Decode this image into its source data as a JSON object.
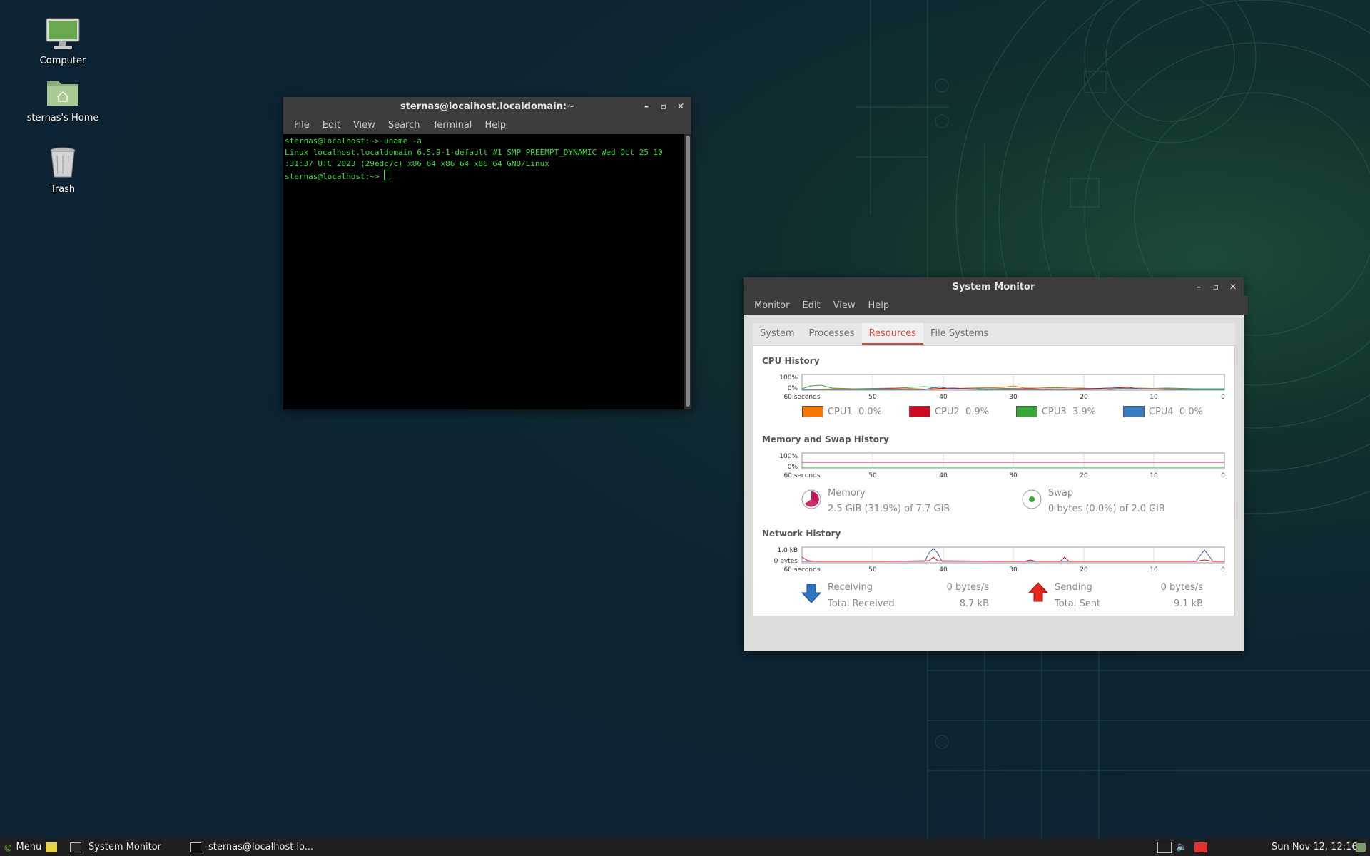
{
  "desktop": {
    "icons": [
      {
        "label": "Computer",
        "icon": "computer-icon"
      },
      {
        "label": "sternas's Home",
        "icon": "home-folder-icon"
      },
      {
        "label": "Trash",
        "icon": "trash-icon"
      }
    ]
  },
  "terminal": {
    "title": "sternas@localhost.localdomain:~",
    "menu": [
      "File",
      "Edit",
      "View",
      "Search",
      "Terminal",
      "Help"
    ],
    "lines": [
      "sternas@localhost:~> uname -a",
      "Linux localhost.localdomain 6.5.9-1-default #1 SMP PREEMPT_DYNAMIC Wed Oct 25 10",
      ":31:37 UTC 2023 (29edc7c) x86_64 x86_64 x86_64 GNU/Linux"
    ],
    "prompt": "sternas@localhost:~> "
  },
  "sysmon": {
    "title": "System Monitor",
    "menu": [
      "Monitor",
      "Edit",
      "View",
      "Help"
    ],
    "tabs": [
      "System",
      "Processes",
      "Resources",
      "File Systems"
    ],
    "active_tab": "Resources",
    "cpu": {
      "section": "CPU History",
      "y_top": "100%",
      "y_bottom": "0%",
      "x_ticks": [
        "60 seconds",
        "50",
        "40",
        "30",
        "20",
        "10",
        "0"
      ],
      "legend": [
        {
          "name": "CPU1",
          "value": "0.0%",
          "color": "#f57900"
        },
        {
          "name": "CPU2",
          "value": "0.9%",
          "color": "#cc0a22"
        },
        {
          "name": "CPU3",
          "value": "3.9%",
          "color": "#3aa53a"
        },
        {
          "name": "CPU4",
          "value": "0.0%",
          "color": "#3a7ac0"
        }
      ]
    },
    "memory": {
      "section": "Memory and Swap History",
      "y_top": "100%",
      "y_bottom": "0%",
      "x_ticks": [
        "60 seconds",
        "50",
        "40",
        "30",
        "20",
        "10",
        "0"
      ],
      "mem_label": "Memory",
      "mem_value": "2.5 GiB (31.9%) of 7.7 GiB",
      "swap_label": "Swap",
      "swap_value": "0 bytes (0.0%) of 2.0 GiB",
      "mem_color": "#c0185e",
      "swap_color": "#3aa53a"
    },
    "network": {
      "section": "Network History",
      "y_top": "1.0 kB",
      "y_bottom": "0 bytes",
      "x_ticks": [
        "60 seconds",
        "50",
        "40",
        "30",
        "20",
        "10",
        "0"
      ],
      "receiving_label": "Receiving",
      "receiving_value": "0 bytes/s",
      "total_received_label": "Total Received",
      "total_received_value": "8.7 kB",
      "sending_label": "Sending",
      "sending_value": "0 bytes/s",
      "total_sent_label": "Total Sent",
      "total_sent_value": "9.1 kB"
    }
  },
  "panel": {
    "menu_label": "Menu",
    "tasks": [
      "System Monitor",
      "sternas@localhost.lo..."
    ],
    "clock": "Sun Nov 12, 12:16"
  }
}
